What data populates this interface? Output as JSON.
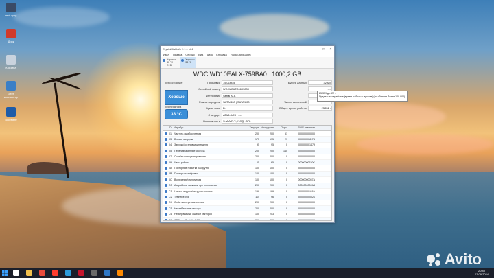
{
  "desktop": {
    "icons": [
      {
        "label": "reniu.png",
        "color": "#3a4b66"
      },
      {
        "label": "Диск",
        "color": "#d13a2a"
      },
      {
        "label": "Корзина",
        "color": "#c9d3de"
      },
      {
        "label": "Этот компьютер",
        "color": "#3a7fc7"
      },
      {
        "label": "Документ",
        "color": "#1f5ca8"
      }
    ],
    "watermark": "Avito"
  },
  "taskbar": {
    "time": "20:40",
    "date": "07.09.2024",
    "apps": [
      {
        "name": "search",
        "color": "#ffffff"
      },
      {
        "name": "explorer",
        "color": "#f2c14e"
      },
      {
        "name": "chrome",
        "color": "#e94b3c"
      },
      {
        "name": "yandex",
        "color": "#ff3d2e"
      },
      {
        "name": "media",
        "color": "#2d9cdb"
      },
      {
        "name": "opera",
        "color": "#c5162e"
      },
      {
        "name": "terminal",
        "color": "#6a6a6a"
      },
      {
        "name": "folder",
        "color": "#2f78c7"
      },
      {
        "name": "firefox",
        "color": "#ff8a00"
      }
    ]
  },
  "window": {
    "title": "CrystalDiskInfo 9.1.1 x64",
    "menu": [
      "Файл",
      "Правка",
      "Сервис",
      "Вид",
      "Диск",
      "Справка",
      "Язык(Language)"
    ],
    "drives": [
      {
        "status": "Хорошо",
        "temp": "40 °C",
        "letter": "С: D:"
      },
      {
        "status": "Хорошо",
        "temp": "33 °C",
        "letter": ""
      }
    ],
    "model": "WDC WD10EALX-759BA0 : 1000,2 GB",
    "health_label": "Техсостояние",
    "health_value": "Хорошо",
    "temp_label": "Температура",
    "temp_value": "33 °C",
    "fields": [
      {
        "label": "Прошивка",
        "value": "15.01H15"
      },
      {
        "label": "Серийный номер",
        "value": "WD-WCATR6699830"
      },
      {
        "label": "Интерфейс",
        "value": "Serial ATA"
      },
      {
        "label": "Режим передачи",
        "value": "SATA/300 | SATA/600"
      },
      {
        "label": "Буква тома",
        "value": "D:"
      },
      {
        "label": "Стандарт",
        "value": "ATA8-ACS | ----"
      },
      {
        "label": "Возможности",
        "value": "S.M.A.R.T., NCQ, GPL"
      }
    ],
    "right_fields": [
      {
        "label": "Буфер данных",
        "value": "32 MB"
      },
      {
        "label": "",
        "value": "----"
      },
      {
        "label": "",
        "value": "----"
      },
      {
        "label": "Число включений",
        "value": ""
      },
      {
        "label": "Общее время работы",
        "value": "25352 ч"
      }
    ],
    "tooltip": "25.359 дн. 22 ч\nПредел по наработке (время работы с диском) (по сбою не более 100 000)",
    "columns": [
      "ID",
      "Атрибут",
      "Текущее",
      "Наихудшее",
      "Порог",
      "RAW-значения"
    ],
    "rows": [
      {
        "id": "01",
        "name": "Частота ошибок чтения",
        "cur": "200",
        "worst": "200",
        "thr": "51",
        "raw": "000000000000"
      },
      {
        "id": "03",
        "name": "Время раскрутки",
        "cur": "175",
        "worst": "175",
        "thr": "21",
        "raw": "000000001D7B"
      },
      {
        "id": "04",
        "name": "Запуски/остановки шпинделя",
        "cur": "95",
        "worst": "95",
        "thr": "0",
        "raw": "000000001479"
      },
      {
        "id": "05",
        "name": "Переназначенные сектора",
        "cur": "200",
        "worst": "200",
        "thr": "140",
        "raw": "000000000000"
      },
      {
        "id": "07",
        "name": "Ошибки позиционирования",
        "cur": "200",
        "worst": "200",
        "thr": "0",
        "raw": "000000000000"
      },
      {
        "id": "09",
        "name": "Часы работы",
        "cur": "65",
        "worst": "65",
        "thr": "0",
        "raw": "00000000630C"
      },
      {
        "id": "0A",
        "name": "Повторные попытки раскрутки",
        "cur": "100",
        "worst": "100",
        "thr": "0",
        "raw": "000000000000"
      },
      {
        "id": "0B",
        "name": "Повторы калибровки",
        "cur": "100",
        "worst": "100",
        "thr": "0",
        "raw": "000000000000"
      },
      {
        "id": "0C",
        "name": "Включения/отключения",
        "cur": "100",
        "worst": "100",
        "thr": "0",
        "raw": "00000000057A"
      },
      {
        "id": "C0",
        "name": "Аварийные парковки при отключении",
        "cur": "200",
        "worst": "200",
        "thr": "0",
        "raw": "0000000002A3"
      },
      {
        "id": "C1",
        "name": "Циклы загрузки/выгрузки головок",
        "cur": "199",
        "worst": "199",
        "thr": "0",
        "raw": "000000001C6A"
      },
      {
        "id": "C2",
        "name": "Температура",
        "cur": "114",
        "worst": "96",
        "thr": "0",
        "raw": "000000000021"
      },
      {
        "id": "C4",
        "name": "События переназначения",
        "cur": "200",
        "worst": "200",
        "thr": "0",
        "raw": "000000000000"
      },
      {
        "id": "C5",
        "name": "Нестабильные сектора",
        "cur": "200",
        "worst": "200",
        "thr": "0",
        "raw": "000000000000"
      },
      {
        "id": "C6",
        "name": "Неисправимые ошибки секторов",
        "cur": "100",
        "worst": "253",
        "thr": "0",
        "raw": "000000000000"
      },
      {
        "id": "C7",
        "name": "CRC-ошибки UltraDMA",
        "cur": "200",
        "worst": "200",
        "thr": "0",
        "raw": "000000000000"
      },
      {
        "id": "C8",
        "name": "Частота ошибок записи",
        "cur": "200",
        "worst": "200",
        "thr": "0",
        "raw": "000000000000"
      },
      {
        "id": "F0",
        "name": "Время позиционирования головок",
        "cur": "100",
        "worst": "253",
        "thr": "0",
        "raw": "000000000000"
      },
      {
        "id": "F1",
        "name": "Время позиционирования (полн.)",
        "cur": "87",
        "worst": "87",
        "thr": "0",
        "raw": "00000000630C"
      }
    ]
  }
}
